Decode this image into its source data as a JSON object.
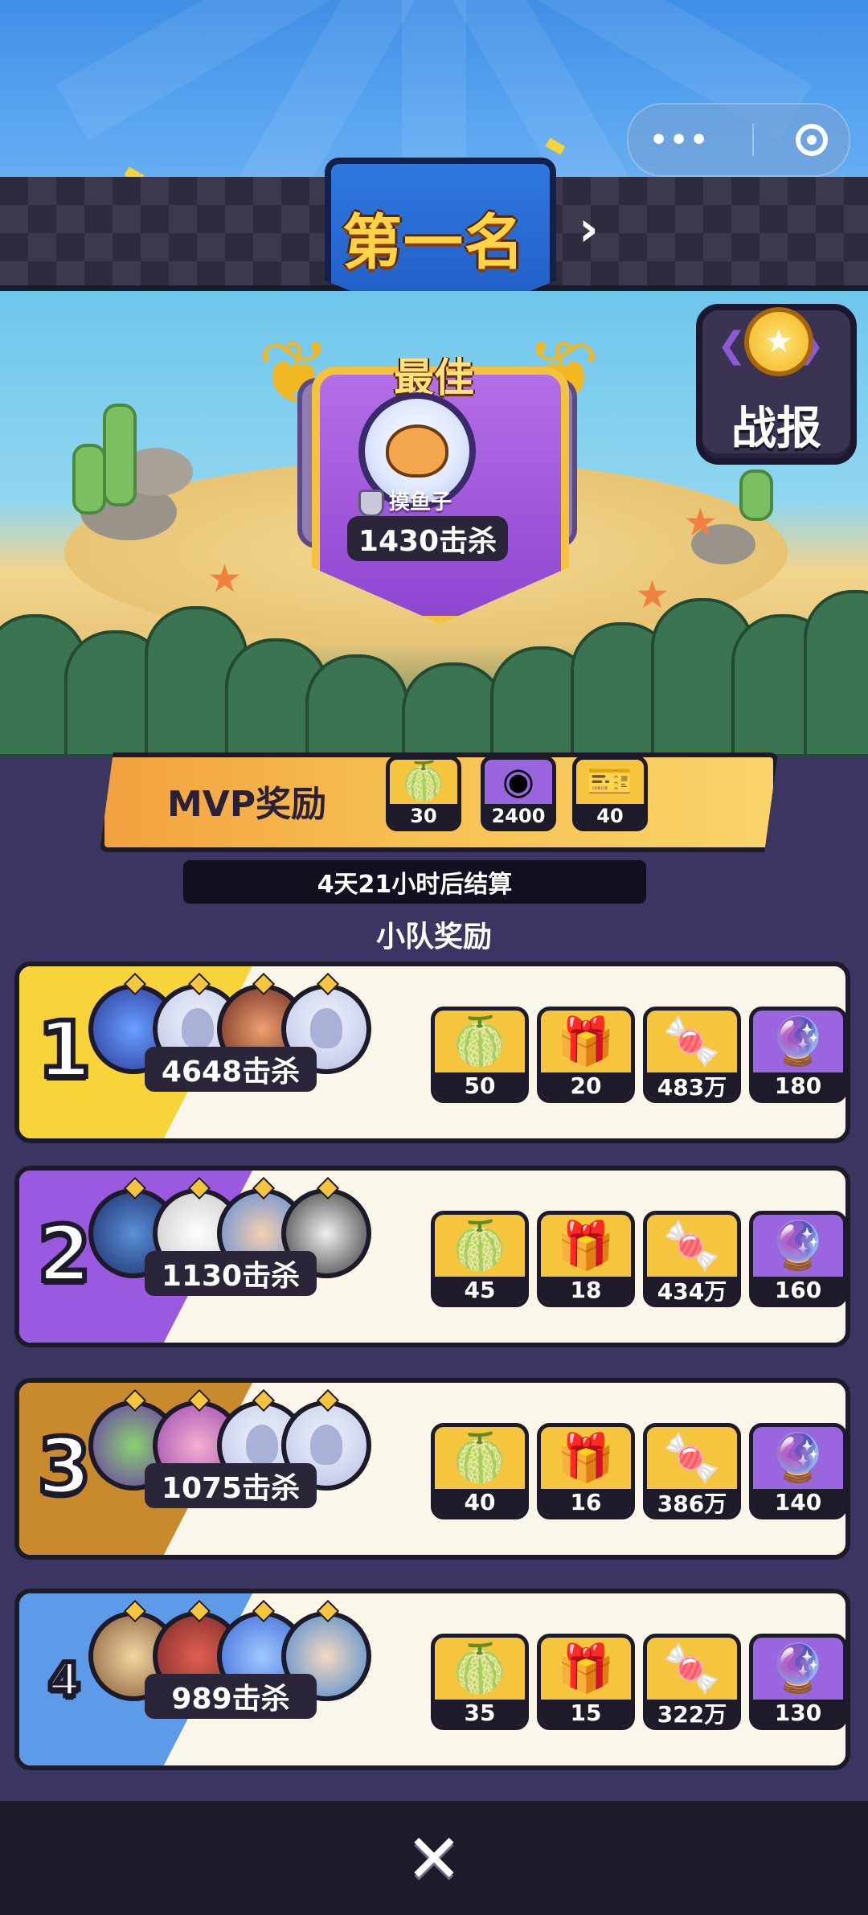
{
  "header": {
    "rank_title": "第一名"
  },
  "mvp": {
    "best_label": "最佳",
    "player_name": "摸鱼子",
    "kills": "1430击杀"
  },
  "report_button": {
    "label": "战报"
  },
  "mvp_reward": {
    "label": "MVP奖励",
    "items": [
      {
        "icon": "durian-fruit-icon",
        "count": "30"
      },
      {
        "icon": "purple-orbs-icon",
        "count": "2400"
      },
      {
        "icon": "ticket-icon",
        "count": "40"
      }
    ]
  },
  "settlement_timer": "4天21小时后结算",
  "squad_reward_title": "小队奖励",
  "teams": [
    {
      "rank": "1",
      "kills": "4648击杀",
      "rewards": [
        {
          "icon": "durian-fruit-icon",
          "count": "50"
        },
        {
          "icon": "mystery-box-icon",
          "count": "20"
        },
        {
          "icon": "gold-candy-icon",
          "count": "483万"
        },
        {
          "icon": "cat-capsule-icon",
          "count": "180"
        }
      ]
    },
    {
      "rank": "2",
      "kills": "1130击杀",
      "rewards": [
        {
          "icon": "durian-fruit-icon",
          "count": "45"
        },
        {
          "icon": "mystery-box-icon",
          "count": "18"
        },
        {
          "icon": "gold-candy-icon",
          "count": "434万"
        },
        {
          "icon": "cat-capsule-icon",
          "count": "160"
        }
      ]
    },
    {
      "rank": "3",
      "kills": "1075击杀",
      "rewards": [
        {
          "icon": "durian-fruit-icon",
          "count": "40"
        },
        {
          "icon": "mystery-box-icon",
          "count": "16"
        },
        {
          "icon": "gold-candy-icon",
          "count": "386万"
        },
        {
          "icon": "cat-capsule-icon",
          "count": "140"
        }
      ]
    },
    {
      "rank": "4",
      "kills": "989击杀",
      "rewards": [
        {
          "icon": "durian-fruit-icon",
          "count": "35"
        },
        {
          "icon": "mystery-box-icon",
          "count": "15"
        },
        {
          "icon": "gold-candy-icon",
          "count": "322万"
        },
        {
          "icon": "cat-capsule-icon",
          "count": "130"
        }
      ]
    }
  ],
  "colors": {
    "gold": "#f5c53e",
    "purple": "#9a66e0",
    "rank1_stripe": "#f7d43a",
    "rank2_stripe": "#9a5ae0",
    "rank3_stripe": "#c98a2e",
    "rank4_stripe": "#5d9be8",
    "dark": "#1d1a2a"
  }
}
